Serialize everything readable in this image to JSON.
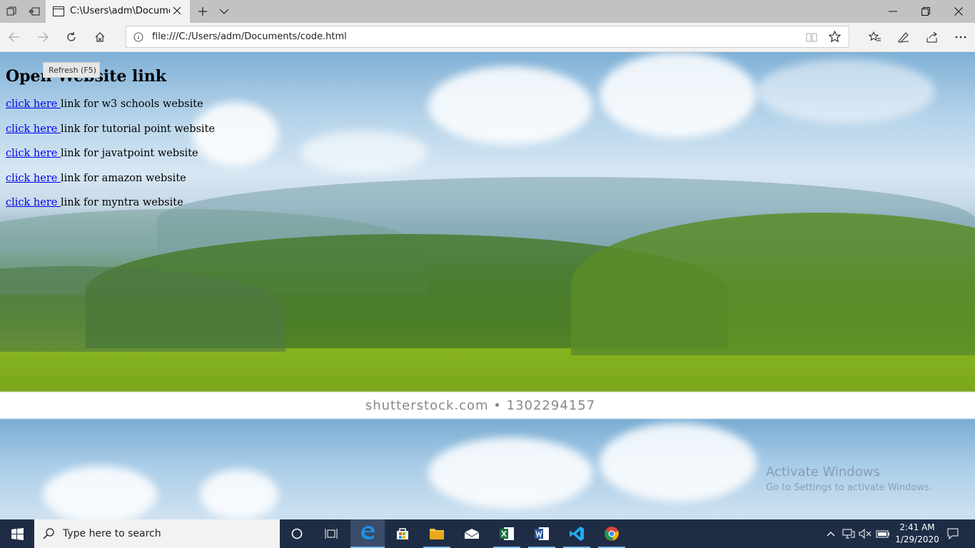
{
  "browser": {
    "tab_title": "C:\\Users\\adm\\Documer",
    "url": "file:///C:/Users/adm/Documents/code.html"
  },
  "page": {
    "heading": "Open Website link",
    "tooltip": "Refresh (F5)",
    "links": [
      {
        "link_text": "click here ",
        "description": "link for w3 schools website"
      },
      {
        "link_text": "click here ",
        "description": "link for tutorial point website"
      },
      {
        "link_text": "click here ",
        "description": "link for javatpoint website"
      },
      {
        "link_text": "click here ",
        "description": "link for amazon website"
      },
      {
        "link_text": "click here ",
        "description": "link for myntra website"
      }
    ],
    "watermark": "shutterstock.com • 1302294157",
    "activate_title": "Activate Windows",
    "activate_sub": "Go to Settings to activate Windows."
  },
  "taskbar": {
    "search_placeholder": "Type here to search",
    "time": "2:41 AM",
    "date": "1/29/2020"
  },
  "colors": {
    "link": "#0000ee",
    "taskbar": "#1e2d45",
    "accent": "#76b9ed"
  }
}
